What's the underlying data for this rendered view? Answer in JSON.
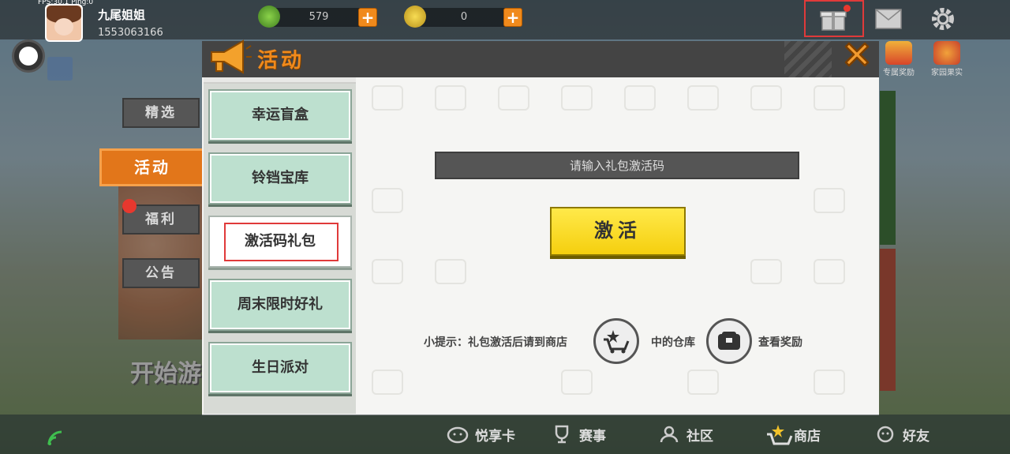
{
  "status": {
    "fps": "FPS:30.1 Ping:0"
  },
  "user": {
    "name": "九尾姐姐",
    "id": "1553063166"
  },
  "currency": [
    {
      "icon": "green-gem-icon",
      "value": "579"
    },
    {
      "icon": "gold-coin-icon",
      "value": "0"
    }
  ],
  "top_rewards": [
    {
      "label": "专属奖励"
    },
    {
      "label": "家园果实"
    }
  ],
  "categories": [
    {
      "label": "精选"
    },
    {
      "label": "活动"
    },
    {
      "label": "福利"
    },
    {
      "label": "公告"
    }
  ],
  "background": {
    "start_text": "开始游"
  },
  "panel": {
    "title": "活动",
    "subtabs": [
      {
        "label": "幸运盲盒"
      },
      {
        "label": "铃铛宝库"
      },
      {
        "label": "激活码礼包"
      },
      {
        "label": "周末限时好礼"
      },
      {
        "label": "生日派对"
      }
    ],
    "code_placeholder": "请输入礼包激活码",
    "activate_label": "激活",
    "tip_prefix": "小提示：礼包激活后请到商店",
    "tip_mid": "中的仓库",
    "tip_suffix": "查看奖励"
  },
  "bottom_nav": [
    {
      "label": "悦享卡",
      "icon": "piggy-icon"
    },
    {
      "label": "赛事",
      "icon": "trophy-icon"
    },
    {
      "label": "社区",
      "icon": "community-icon"
    },
    {
      "label": "商店",
      "icon": "shop-cart-icon"
    },
    {
      "label": "好友",
      "icon": "friends-icon"
    }
  ],
  "colors": {
    "accent": "#f08a1c",
    "highlight": "#e03a3a",
    "button": "#f5cf0e"
  }
}
